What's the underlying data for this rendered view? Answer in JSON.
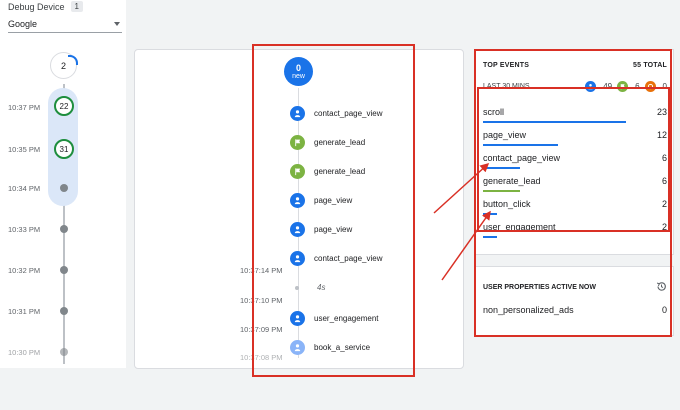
{
  "debug": {
    "label": "Debug Device",
    "count": "1",
    "device": "Google"
  },
  "minutes": {
    "top_count": "2",
    "rows": [
      {
        "time": "10:37 PM",
        "count": "22"
      },
      {
        "time": "10:35 PM",
        "count": "31"
      },
      {
        "time": "10:34 PM"
      },
      {
        "time": "10:33 PM"
      },
      {
        "time": "10:32 PM"
      },
      {
        "time": "10:31 PM"
      },
      {
        "time": "10:30 PM"
      }
    ]
  },
  "stream": {
    "new_count": "0",
    "new_label": "new",
    "events": [
      {
        "name": "contact_page_view",
        "icon": "person-icon"
      },
      {
        "name": "generate_lead",
        "icon": "flag-icon"
      },
      {
        "name": "generate_lead",
        "icon": "flag-icon"
      },
      {
        "name": "page_view",
        "icon": "person-icon"
      },
      {
        "name": "page_view",
        "icon": "person-icon"
      },
      {
        "name": "contact_page_view",
        "icon": "person-icon"
      },
      {
        "name": "4s",
        "icon": "gap-dot"
      },
      {
        "name": "user_engagement",
        "icon": "person-icon"
      },
      {
        "name": "book_a_service",
        "icon": "person-icon"
      }
    ],
    "timestamps": [
      "10:37:14 PM",
      "10:37:10 PM",
      "10:37:09 PM",
      "10:37:08 PM"
    ]
  },
  "top_events": {
    "title": "TOP EVENTS",
    "total": "55 TOTAL",
    "period": "LAST 30 MINS",
    "counts": {
      "events": "49",
      "conversions": "6",
      "errors": "0"
    },
    "rows": [
      {
        "name": "scroll",
        "value": "23",
        "bar_color": "#1a73e8",
        "share": 0.42
      },
      {
        "name": "page_view",
        "value": "12",
        "bar_color": "#1a73e8",
        "share": 0.22
      },
      {
        "name": "contact_page_view",
        "value": "6",
        "bar_color": "#1a73e8",
        "share": 0.11
      },
      {
        "name": "generate_lead",
        "value": "6",
        "bar_color": "#7cb342",
        "share": 0.11
      },
      {
        "name": "button_click",
        "value": "2",
        "bar_color": "#1a73e8",
        "share": 0.04
      },
      {
        "name": "user_engagement",
        "value": "2",
        "bar_color": "#1a73e8",
        "share": 0.04
      }
    ]
  },
  "user_properties": {
    "title": "USER PROPERTIES ACTIVE NOW",
    "rows": [
      {
        "name": "non_personalized_ads",
        "value": "0"
      }
    ]
  },
  "colors": {
    "accent": "#1a73e8",
    "conversion": "#7cb342",
    "error": "#e8710a",
    "annotation": "#d93025"
  }
}
